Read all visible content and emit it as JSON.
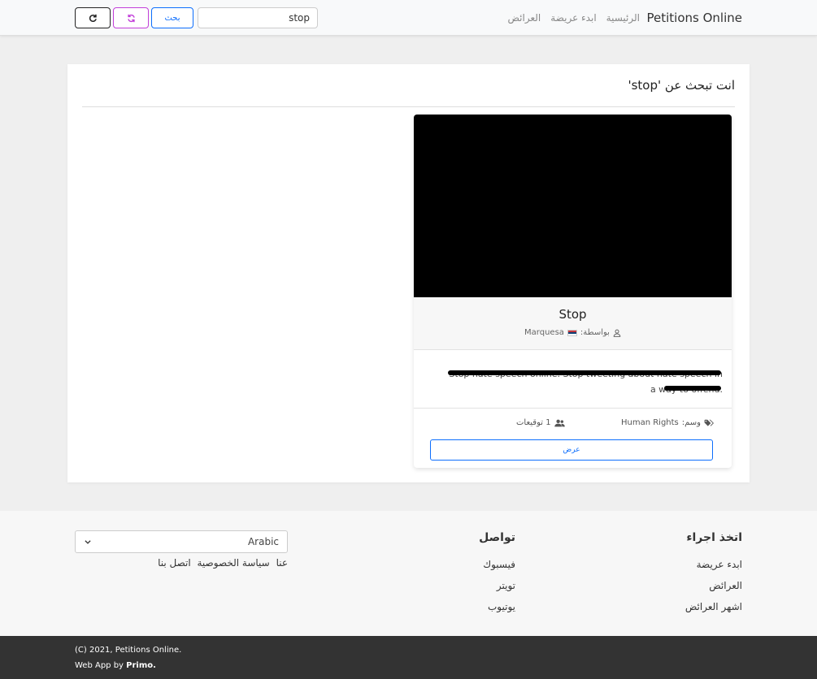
{
  "nav": {
    "brand": "Petitions Online",
    "links": [
      "الرئيسية",
      "ابدء عريضة",
      "العرائض"
    ],
    "search_value": "stop",
    "search_button": "بحث"
  },
  "results": {
    "title": "انت تبحث عن 'stop'",
    "petition": {
      "title": "Stop",
      "by_label": "بواسطة:",
      "author": "Marquesa",
      "description": "Stop hate speech online. Stop tweeting about hate speech in a way to offend.",
      "tag_label": "وسم:",
      "tag": "Human Rights",
      "signatures": "1 توقيعات",
      "view_button": "عرض"
    }
  },
  "footer": {
    "take_action": {
      "heading": "اتخذ اجراء",
      "links": [
        "ابدء عريضة",
        "العرائض",
        "اشهر العرائض"
      ]
    },
    "connect": {
      "heading": "تواصل",
      "links": [
        "فيسبوك",
        "تويتر",
        "يوتيوب"
      ]
    },
    "language": "Arabic",
    "policy_links": [
      "عنا",
      "سياسة الخصوصية",
      "اتصل بنا"
    ],
    "copyright": "(C) 2021, Petitions Online.",
    "webapp_prefix": "Web App by",
    "webapp_author": "Primo."
  },
  "icons": [
    "user-icon",
    "tags-icon",
    "users-icon",
    "sync-icon",
    "reload-icon",
    "chevron-down-icon"
  ],
  "colors": {
    "primary": "#0d6efd",
    "sync": "#c23fd9",
    "footer_dark": "#333333"
  }
}
